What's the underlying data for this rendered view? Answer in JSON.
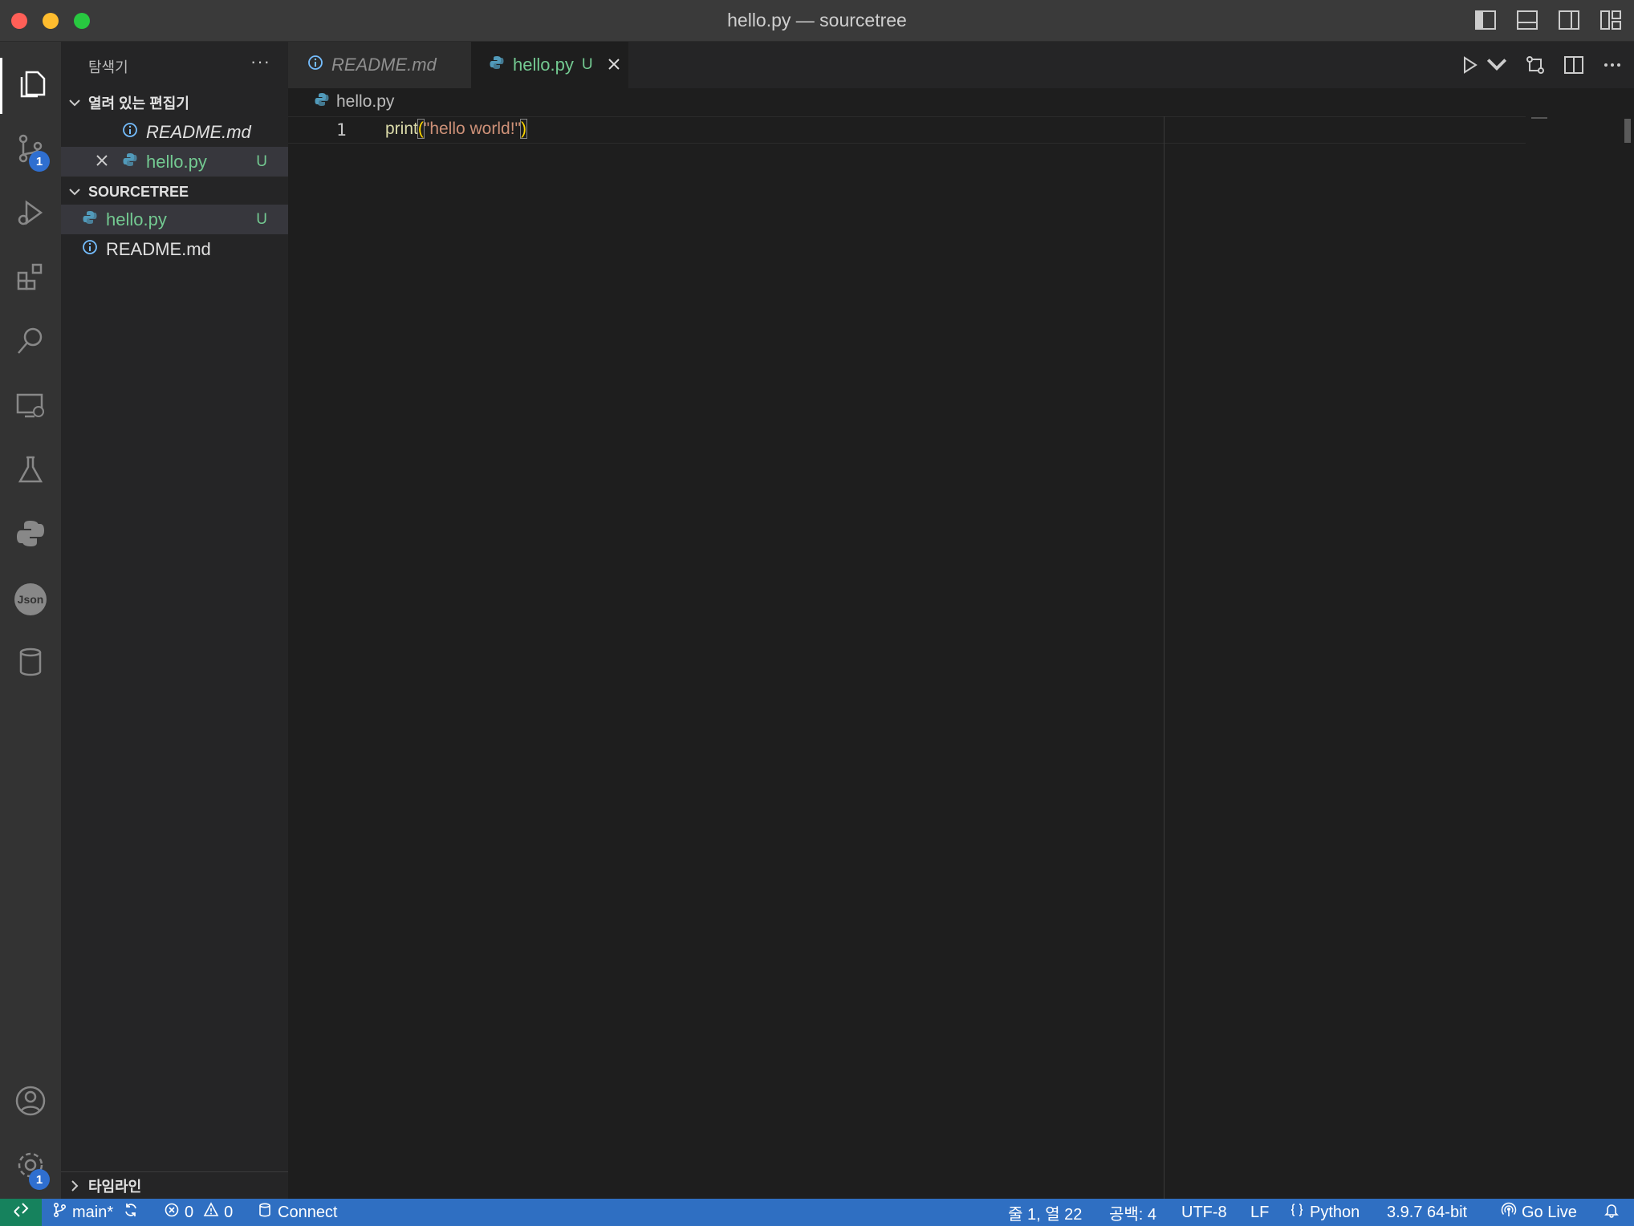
{
  "window": {
    "title": "hello.py — sourcetree"
  },
  "sidebar": {
    "title": "탐색기",
    "more": "···",
    "open_editors": {
      "header": "열려 있는 편집기",
      "items": [
        {
          "name": "README.md",
          "status": ""
        },
        {
          "name": "hello.py",
          "status": "U"
        }
      ]
    },
    "workspace": {
      "header": "SOURCETREE",
      "items": [
        {
          "name": "hello.py",
          "status": "U"
        },
        {
          "name": "README.md",
          "status": ""
        }
      ]
    },
    "timeline": "타임라인"
  },
  "activity": {
    "badges": {
      "source_control": "1",
      "settings": "1"
    },
    "json_label": "Json"
  },
  "tabs": [
    {
      "label": "README.md",
      "status": ""
    },
    {
      "label": "hello.py",
      "status": "U"
    }
  ],
  "editor": {
    "breadcrumb": "hello.py",
    "line_number": "1",
    "code": {
      "func": "print",
      "open": "(",
      "string": "\"hello world!\"",
      "close": ")"
    }
  },
  "statusbar": {
    "branch": "main*",
    "errors": "0",
    "warnings": "0",
    "connect": "Connect",
    "position": "줄 1, 열 22",
    "spaces": "공백: 4",
    "encoding": "UTF-8",
    "eol": "LF",
    "language": "Python",
    "interpreter": "3.9.7 64-bit",
    "golive": "Go Live"
  },
  "colors": {
    "accent": "#2f6fc2",
    "untracked": "#73c991",
    "remote": "#16825d"
  }
}
